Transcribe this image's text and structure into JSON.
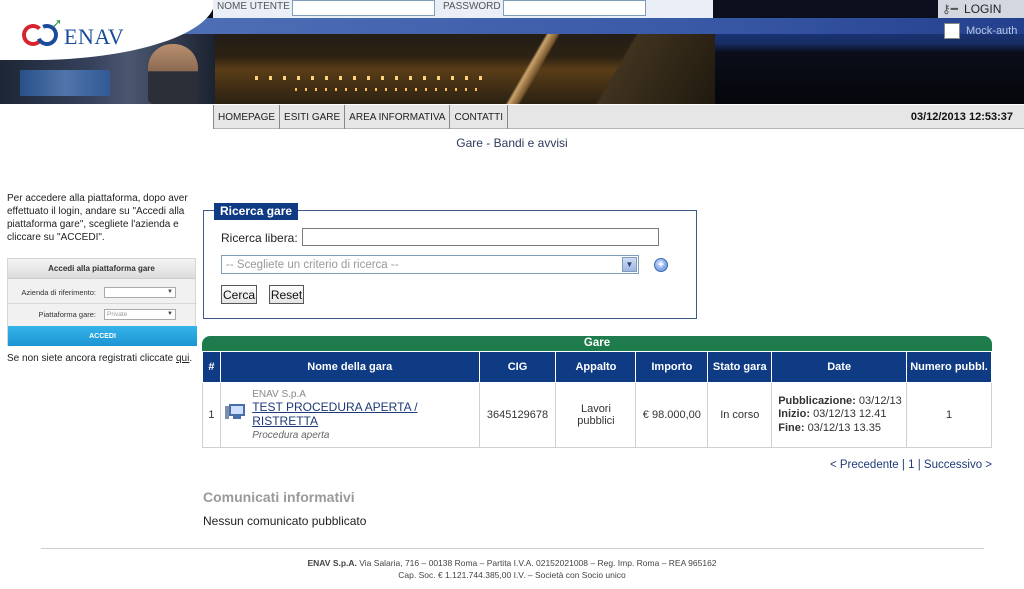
{
  "header": {
    "logo_text": "ENAV",
    "username_label": "NOME UTENTE",
    "password_label": "PASSWORD",
    "login_label": "LOGIN",
    "mock_auth_label": "Mock-auth"
  },
  "nav": {
    "items": [
      "HOMEPAGE",
      "ESITI GARE",
      "AREA INFORMATIVA",
      "CONTATTI"
    ],
    "datetime": "03/12/2013 12:53:37"
  },
  "page": {
    "title": "Gare - Bandi e avvisi"
  },
  "sidebar": {
    "info_text": "Per accedere alla piattaforma, dopo aver effettuato il login, andare su \"Accedi alla piattaforma gare\", scegliete l'azienda e cliccare su \"ACCEDI\".",
    "box_title": "Accedi alla piattaforma gare",
    "company_label": "Azienda di riferimento:",
    "company_value": "",
    "platform_label": "Piattaforma gare:",
    "platform_value": "Private",
    "accedi_label": "ACCEDI",
    "register_text": "Se non siete ancora registrati cliccate",
    "register_link": "qui",
    "register_end": "."
  },
  "search": {
    "legend": "Ricerca gare",
    "free_label": "Ricerca libera:",
    "free_value": "",
    "criteria_placeholder": "-- Scegliete un criterio di ricerca --",
    "search_button": "Cerca",
    "reset_button": "Reset"
  },
  "table": {
    "caption": "Gare",
    "columns": [
      "#",
      "Nome della gara",
      "CIG",
      "Appalto",
      "Importo",
      "Stato gara",
      "Date",
      "Numero pubbl."
    ],
    "rows": [
      {
        "num": "1",
        "company": "ENAV S.p.A",
        "name": "TEST PROCEDURA APERTA / RISTRETTA",
        "procedure": "Procedura aperta",
        "cig": "3645129678",
        "appalto": "Lavori pubblici",
        "importo": "€ 98.000,00",
        "stato": "In corso",
        "pubblicazione_label": "Pubblicazione:",
        "pubblicazione": "03/12/13",
        "inizio_label": "Inizio:",
        "inizio": "03/12/13 12.41",
        "fine_label": "Fine:",
        "fine": "03/12/13 13.35",
        "numero_pubbl": "1"
      }
    ]
  },
  "pager": {
    "prev": "< Precedente",
    "sep1": "|",
    "page": "1",
    "sep2": "|",
    "next": "Successivo >"
  },
  "comunicati": {
    "title": "Comunicati informativi",
    "empty_text": "Nessun comunicato pubblicato"
  },
  "footer": {
    "company": "ENAV S.p.A.",
    "line1": "Via Salaria, 716 – 00138 Roma – Partita I.V.A. 02152021008 – Reg. Imp. Roma – REA 965162",
    "line2": "Cap. Soc. € 1.121.744.385,00 I.V. – Società con Socio unico"
  }
}
